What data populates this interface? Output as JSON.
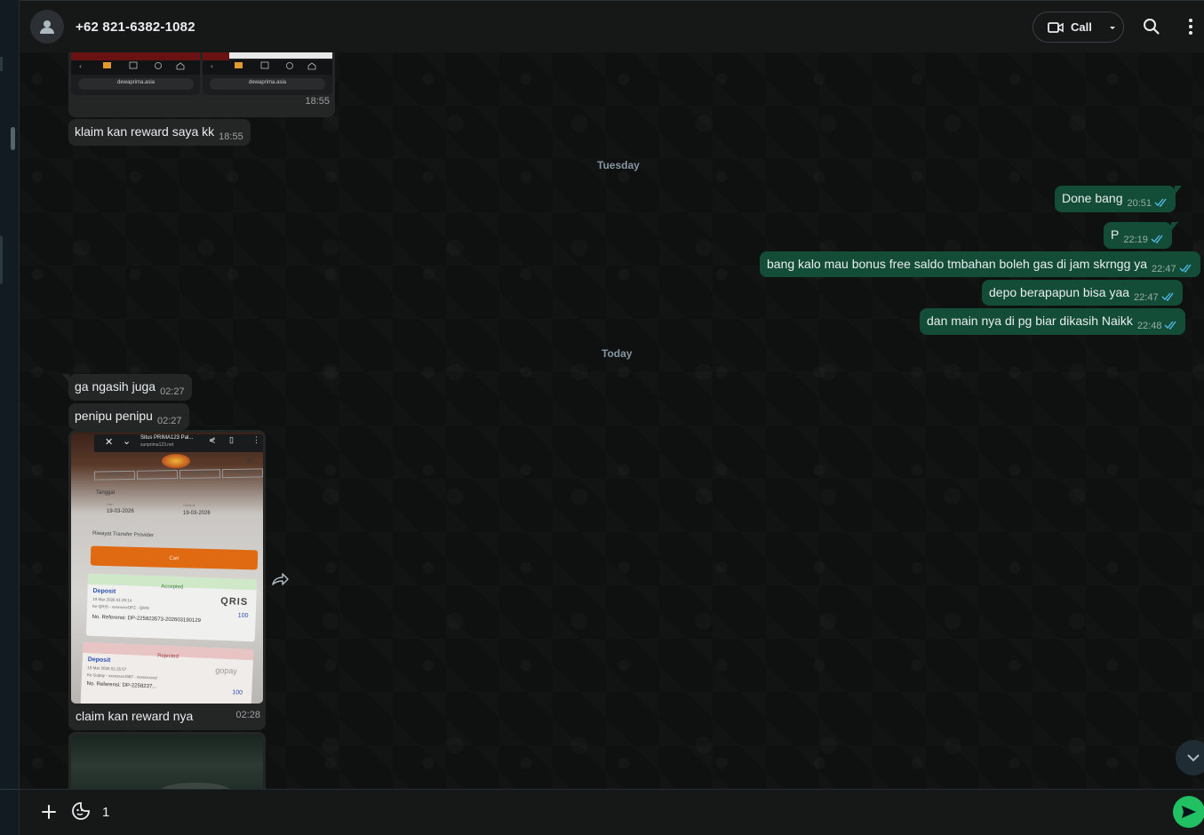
{
  "header": {
    "contact_name": "+62 821-6382-1082",
    "call_label": "Call",
    "icons": [
      "default-avatar-icon",
      "video-camera-icon",
      "chevron-down-icon",
      "search-icon",
      "kebab-menu-icon"
    ]
  },
  "messages": {
    "m1": {
      "time": "18:55",
      "shot_labels": [
        "dewaprima.asia",
        "dewaprima.asia"
      ]
    },
    "m2": {
      "text": "klaim kan reward saya kk",
      "time": "18:55"
    },
    "day1": "Tuesday",
    "o1": {
      "text": "Done bang",
      "time": "20:51"
    },
    "o2": {
      "text": "P",
      "time": "22:19"
    },
    "o3": {
      "text": "bang kalo mau bonus free saldo tmbahan boleh gas di jam skrngg ya",
      "time": "22:47"
    },
    "o4": {
      "text": "depo berapapun bisa yaa",
      "time": "22:47"
    },
    "o5": {
      "text": "dan main nya di pg biar dikasih Naikk",
      "time": "22:48"
    },
    "day2": "Today",
    "i1": {
      "text": "ga ngasih juga",
      "time": "02:27"
    },
    "i2": {
      "text": "penipu penipu",
      "time": "02:27"
    },
    "i3": {
      "caption": "claim kan reward nya",
      "time": "02:28",
      "shot": {
        "site_title": "Situs PRIMA123 Pal...",
        "site_url": "sunprima123.net",
        "tabs": [
          "Rekening",
          "Deposit",
          "Transfer",
          "Withdraw"
        ],
        "date_label": "Tanggal",
        "from_label": "Dari",
        "from_date": "19-03-2026",
        "to_label": "Sampai",
        "to_date": "19-03-2026",
        "history_label": "Riwayat Transfer Provider",
        "search_button": "Cari",
        "accepted_label": "Accepted",
        "deposit_label": "Deposit",
        "deposit1_date": "19 Mar 2026 01:29:14",
        "deposit1_ke": "Ke QRIS - xxxxxxxxOPZ - QRIS",
        "deposit1_ref": "No. Referensi: DP-225823573-202603190129",
        "deposit1_amount": "100",
        "deposit1_brand": "QRIS",
        "rejected_label": "Rejected",
        "deposit2_date": "19 Mar 2026 01:25:57",
        "deposit2_ke": "Ke Gopay - xxxxxxxx1567 - xxxxxxxxxd",
        "deposit2_ref": "No. Referensi: DP-2258237...",
        "deposit2_brand": "gopay",
        "deposit2_amount": "100"
      }
    }
  },
  "composer": {
    "value": "1",
    "placeholder": ""
  },
  "colors": {
    "outgoing_bubble": "#144d37",
    "incoming_bubble": "#242626",
    "send_button": "#21c063",
    "read_ticks": "#53bdeb"
  }
}
